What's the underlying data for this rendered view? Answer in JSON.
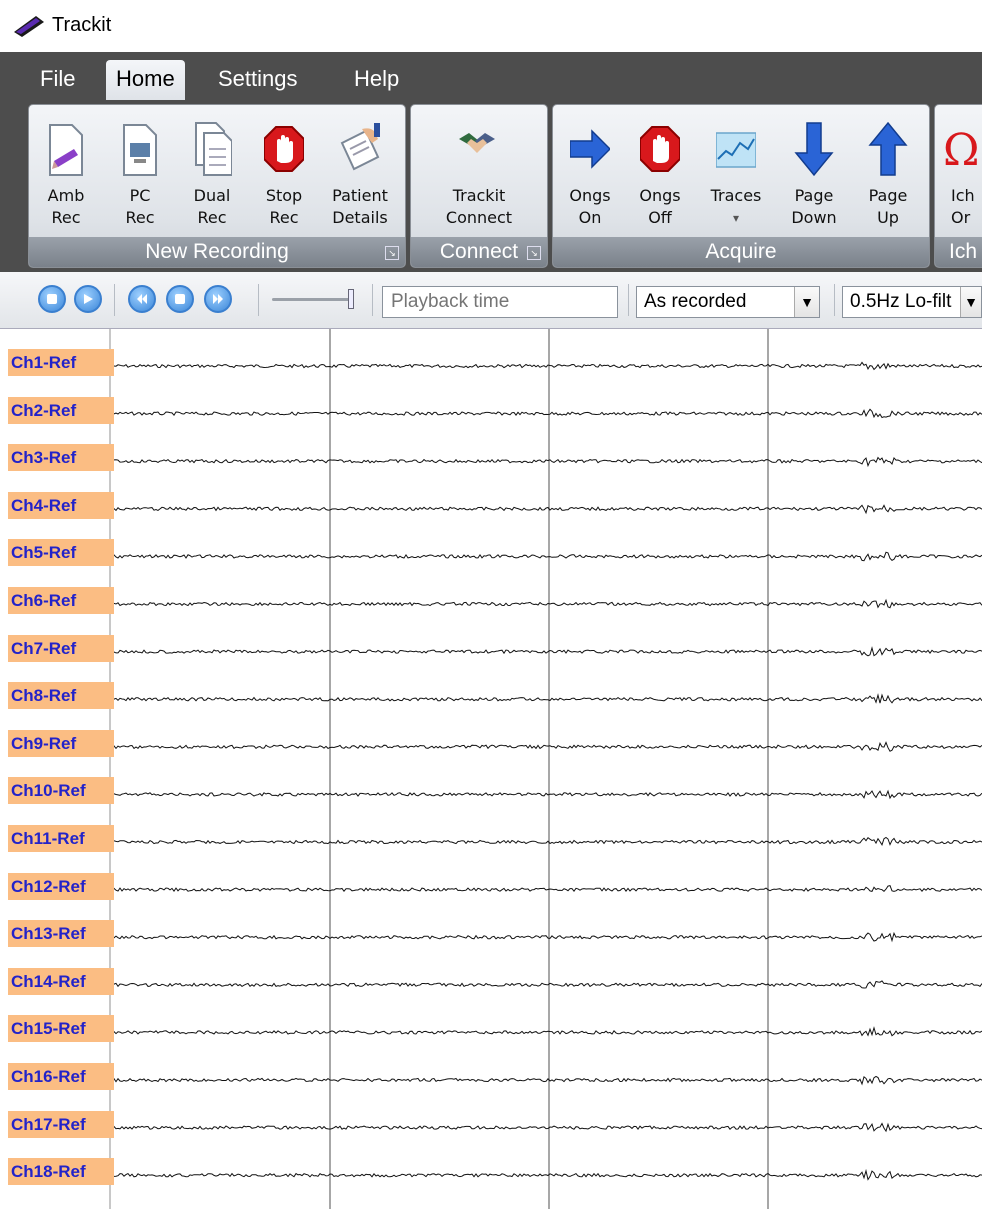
{
  "window": {
    "title": "Trackit"
  },
  "menu": {
    "items": [
      "File",
      "Home",
      "Settings",
      "Help"
    ],
    "active": "Home"
  },
  "ribbon": {
    "groups": {
      "new_recording": {
        "label": "New Recording",
        "buttons": [
          {
            "line1": "Amb",
            "line2": "Rec"
          },
          {
            "line1": "PC",
            "line2": "Rec"
          },
          {
            "line1": "Dual",
            "line2": "Rec"
          },
          {
            "line1": "Stop",
            "line2": "Rec"
          },
          {
            "line1": "Patient",
            "line2": "Details"
          }
        ]
      },
      "connect": {
        "label": "Connect",
        "buttons": [
          {
            "line1": "Trackit",
            "line2": "Connect"
          }
        ]
      },
      "acquire": {
        "label": "Acquire",
        "buttons": [
          {
            "line1": "Ongs",
            "line2": "On"
          },
          {
            "line1": "Ongs",
            "line2": "Off"
          },
          {
            "line1": "Traces",
            "line2": "▾"
          },
          {
            "line1": "Page",
            "line2": "Down"
          },
          {
            "line1": "Page",
            "line2": "Up"
          }
        ]
      },
      "partial": {
        "label": "Ich",
        "button": {
          "line1": "Ich",
          "line2": "Or"
        }
      }
    }
  },
  "toolbar": {
    "playback_placeholder": "Playback time",
    "montage_value": "As recorded",
    "filter_value": "0.5Hz Lo-filt"
  },
  "channels": [
    "Ch1-Ref",
    "Ch2-Ref",
    "Ch3-Ref",
    "Ch4-Ref",
    "Ch5-Ref",
    "Ch6-Ref",
    "Ch7-Ref",
    "Ch8-Ref",
    "Ch9-Ref",
    "Ch10-Ref",
    "Ch11-Ref",
    "Ch12-Ref",
    "Ch13-Ref",
    "Ch14-Ref",
    "Ch15-Ref",
    "Ch16-Ref",
    "Ch17-Ref",
    "Ch18-Ref"
  ],
  "colors": {
    "label_bg": "#fbbd83",
    "label_text": "#2323c9",
    "ribbon_dark": "#4d4d4d"
  }
}
